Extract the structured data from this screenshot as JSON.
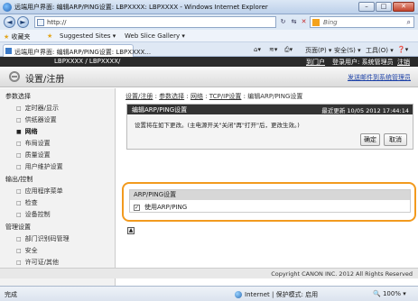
{
  "window": {
    "title": "远端用户界面: 编辑ARP/PING设置: LBPXXXX: LBPXXXX - Windows Internet Explorer",
    "minimize": "–",
    "maximize": "□",
    "close": "✕"
  },
  "browser": {
    "back": "◄",
    "forward": "►",
    "address": "http://",
    "search_placeholder": "Bing",
    "favorites": "收藏夹",
    "suggested_sites": "Suggested Sites ▾",
    "web_slice": "Web Slice Gallery ▾",
    "tab_title": "远端用户界面: 编辑ARP/PING设置: LBPXXXX...",
    "commands": {
      "page": "页面(P) ▾",
      "safety": "安全(S) ▾",
      "tools": "工具(O) ▾",
      "help": "❓▾"
    }
  },
  "app": {
    "device": "LBPXXXX / LBPXXXX/",
    "portal_link": "到门户",
    "login_user": "登录用户: 系统管理员",
    "logout": "注销",
    "page_title": "设置/注册",
    "mail_link": "发送邮件到系统管理员"
  },
  "sidebar": {
    "groups": [
      {
        "title": "参数选择",
        "items": [
          "定时器/显示",
          "供纸器设置",
          "网络",
          "布局设置",
          "质量设置",
          "用户维护设置"
        ]
      },
      {
        "title": "输出/控制",
        "items": [
          "应用程序菜单",
          "检查",
          "设备控制"
        ]
      },
      {
        "title": "管理设置",
        "items": [
          "部门识别码管理",
          "安全",
          "许可证/其他"
        ]
      }
    ],
    "selected": "网络"
  },
  "main": {
    "breadcrumb": {
      "part1": "设置/注册",
      "sep": " : ",
      "part2": "参数选择",
      "part3": "网络",
      "part4": "TCP/IP设置",
      "current": "编辑ARP/PING设置"
    },
    "dialog": {
      "title": "编辑ARP/PING设置",
      "date": "最近更新 10/05 2012 17:44:14",
      "message": "设置将在如下更改。(主电源开关\"关闭\"再\"打开\"后，更改生效。)",
      "ok": "确定",
      "cancel": "取消"
    },
    "section": {
      "title": "ARP/PING设置",
      "checkbox_label": "使用ARP/PING",
      "checkbox_mark": "✓"
    },
    "top_icon": "▲",
    "copyright": "Copyright CANON INC. 2012 All Rights Reserved"
  },
  "statusbar": {
    "left": "完成",
    "zone": "Internet | 保护模式: 启用",
    "zoom": "100% ▾"
  }
}
